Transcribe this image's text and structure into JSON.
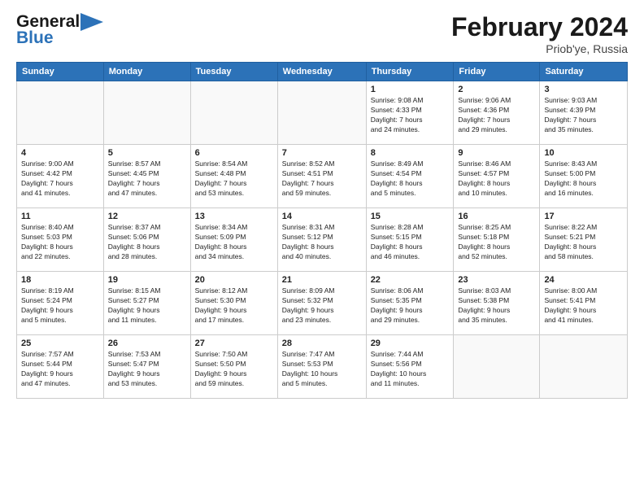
{
  "header": {
    "logo_general": "General",
    "logo_blue": "Blue",
    "month_title": "February 2024",
    "location": "Priob'ye, Russia"
  },
  "days_of_week": [
    "Sunday",
    "Monday",
    "Tuesday",
    "Wednesday",
    "Thursday",
    "Friday",
    "Saturday"
  ],
  "weeks": [
    [
      {
        "day": "",
        "info": ""
      },
      {
        "day": "",
        "info": ""
      },
      {
        "day": "",
        "info": ""
      },
      {
        "day": "",
        "info": ""
      },
      {
        "day": "1",
        "info": "Sunrise: 9:08 AM\nSunset: 4:33 PM\nDaylight: 7 hours\nand 24 minutes."
      },
      {
        "day": "2",
        "info": "Sunrise: 9:06 AM\nSunset: 4:36 PM\nDaylight: 7 hours\nand 29 minutes."
      },
      {
        "day": "3",
        "info": "Sunrise: 9:03 AM\nSunset: 4:39 PM\nDaylight: 7 hours\nand 35 minutes."
      }
    ],
    [
      {
        "day": "4",
        "info": "Sunrise: 9:00 AM\nSunset: 4:42 PM\nDaylight: 7 hours\nand 41 minutes."
      },
      {
        "day": "5",
        "info": "Sunrise: 8:57 AM\nSunset: 4:45 PM\nDaylight: 7 hours\nand 47 minutes."
      },
      {
        "day": "6",
        "info": "Sunrise: 8:54 AM\nSunset: 4:48 PM\nDaylight: 7 hours\nand 53 minutes."
      },
      {
        "day": "7",
        "info": "Sunrise: 8:52 AM\nSunset: 4:51 PM\nDaylight: 7 hours\nand 59 minutes."
      },
      {
        "day": "8",
        "info": "Sunrise: 8:49 AM\nSunset: 4:54 PM\nDaylight: 8 hours\nand 5 minutes."
      },
      {
        "day": "9",
        "info": "Sunrise: 8:46 AM\nSunset: 4:57 PM\nDaylight: 8 hours\nand 10 minutes."
      },
      {
        "day": "10",
        "info": "Sunrise: 8:43 AM\nSunset: 5:00 PM\nDaylight: 8 hours\nand 16 minutes."
      }
    ],
    [
      {
        "day": "11",
        "info": "Sunrise: 8:40 AM\nSunset: 5:03 PM\nDaylight: 8 hours\nand 22 minutes."
      },
      {
        "day": "12",
        "info": "Sunrise: 8:37 AM\nSunset: 5:06 PM\nDaylight: 8 hours\nand 28 minutes."
      },
      {
        "day": "13",
        "info": "Sunrise: 8:34 AM\nSunset: 5:09 PM\nDaylight: 8 hours\nand 34 minutes."
      },
      {
        "day": "14",
        "info": "Sunrise: 8:31 AM\nSunset: 5:12 PM\nDaylight: 8 hours\nand 40 minutes."
      },
      {
        "day": "15",
        "info": "Sunrise: 8:28 AM\nSunset: 5:15 PM\nDaylight: 8 hours\nand 46 minutes."
      },
      {
        "day": "16",
        "info": "Sunrise: 8:25 AM\nSunset: 5:18 PM\nDaylight: 8 hours\nand 52 minutes."
      },
      {
        "day": "17",
        "info": "Sunrise: 8:22 AM\nSunset: 5:21 PM\nDaylight: 8 hours\nand 58 minutes."
      }
    ],
    [
      {
        "day": "18",
        "info": "Sunrise: 8:19 AM\nSunset: 5:24 PM\nDaylight: 9 hours\nand 5 minutes."
      },
      {
        "day": "19",
        "info": "Sunrise: 8:15 AM\nSunset: 5:27 PM\nDaylight: 9 hours\nand 11 minutes."
      },
      {
        "day": "20",
        "info": "Sunrise: 8:12 AM\nSunset: 5:30 PM\nDaylight: 9 hours\nand 17 minutes."
      },
      {
        "day": "21",
        "info": "Sunrise: 8:09 AM\nSunset: 5:32 PM\nDaylight: 9 hours\nand 23 minutes."
      },
      {
        "day": "22",
        "info": "Sunrise: 8:06 AM\nSunset: 5:35 PM\nDaylight: 9 hours\nand 29 minutes."
      },
      {
        "day": "23",
        "info": "Sunrise: 8:03 AM\nSunset: 5:38 PM\nDaylight: 9 hours\nand 35 minutes."
      },
      {
        "day": "24",
        "info": "Sunrise: 8:00 AM\nSunset: 5:41 PM\nDaylight: 9 hours\nand 41 minutes."
      }
    ],
    [
      {
        "day": "25",
        "info": "Sunrise: 7:57 AM\nSunset: 5:44 PM\nDaylight: 9 hours\nand 47 minutes."
      },
      {
        "day": "26",
        "info": "Sunrise: 7:53 AM\nSunset: 5:47 PM\nDaylight: 9 hours\nand 53 minutes."
      },
      {
        "day": "27",
        "info": "Sunrise: 7:50 AM\nSunset: 5:50 PM\nDaylight: 9 hours\nand 59 minutes."
      },
      {
        "day": "28",
        "info": "Sunrise: 7:47 AM\nSunset: 5:53 PM\nDaylight: 10 hours\nand 5 minutes."
      },
      {
        "day": "29",
        "info": "Sunrise: 7:44 AM\nSunset: 5:56 PM\nDaylight: 10 hours\nand 11 minutes."
      },
      {
        "day": "",
        "info": ""
      },
      {
        "day": "",
        "info": ""
      }
    ]
  ]
}
